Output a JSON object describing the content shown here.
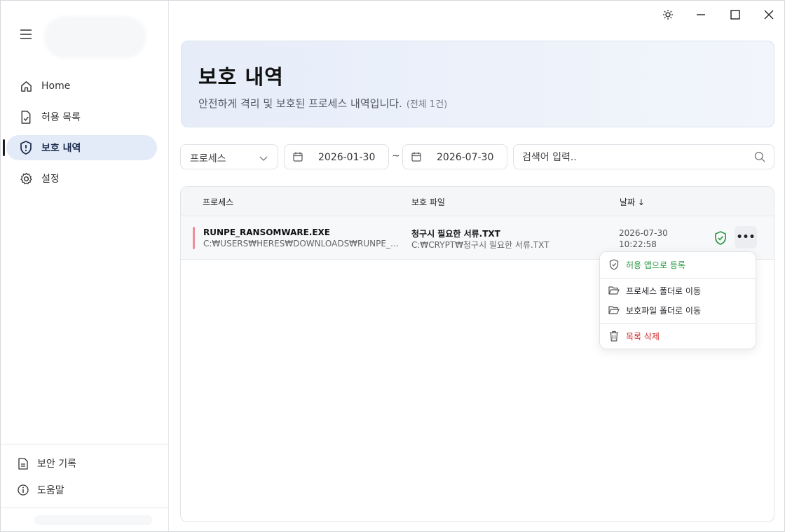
{
  "sidebar": {
    "items": [
      {
        "label": "Home",
        "icon": "home-icon",
        "active": false
      },
      {
        "label": "허용 목록",
        "icon": "file-check-icon",
        "active": false
      },
      {
        "label": "보호 내역",
        "icon": "shield-alert-icon",
        "active": true
      },
      {
        "label": "설정",
        "icon": "gear-icon",
        "active": false
      }
    ],
    "bottom": [
      {
        "label": "보안 기록",
        "icon": "document-icon"
      },
      {
        "label": "도움말",
        "icon": "info-icon"
      }
    ]
  },
  "header": {
    "title": "보호 내역",
    "subtitle": "안전하게 격리 및 보호된 프로세스 내역입니다.",
    "count": "(전체 1건)"
  },
  "filters": {
    "process_select": "프로세스",
    "date_from": "2026-01-30",
    "date_separator": "~",
    "date_to": "2026-07-30",
    "search_placeholder": "검색어 입력.."
  },
  "table": {
    "columns": [
      "프로세스",
      "보호 파일",
      "날짜 ↓"
    ],
    "rows": [
      {
        "process_name": "RUNPE_RANSOMWARE.EXE",
        "process_path": "C:₩USERS₩HERES₩DOWNLOADS₩RUNPE_RANS...",
        "file_name": "청구시 필요한 서류.TXT",
        "file_path": "C:₩CRYPT₩청구시 필요한 서류.TXT",
        "date": "2026-07-30",
        "time": "10:22:58",
        "more": "•••"
      }
    ]
  },
  "context_menu": {
    "allow": "허용 앱으로 등록",
    "open_process_folder": "프로세스 폴더로 이동",
    "open_protected_folder": "보호파일 폴더로 이동",
    "delete": "목록 삭제"
  },
  "colors": {
    "accent_active": "#e3ebf8",
    "success": "#2e9a44",
    "danger": "#d12b2b",
    "row_marker": "#ef8d98"
  }
}
